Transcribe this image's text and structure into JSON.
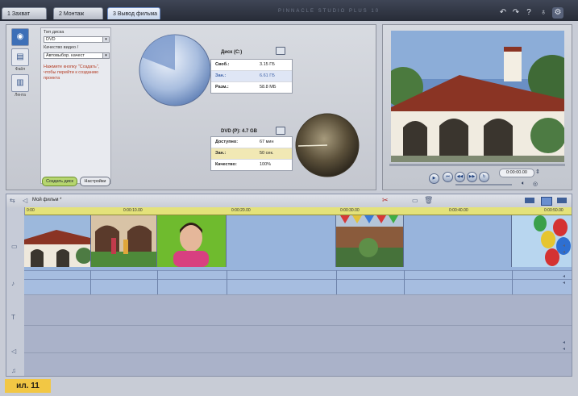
{
  "tabs": [
    {
      "label": "1 Захват"
    },
    {
      "label": "2 Монтаж"
    },
    {
      "label": "3 Вывод фильма"
    }
  ],
  "brand_text": "PINNACLE STUDIO PLUS 10",
  "toolbar_icons": [
    "undo-icon",
    "redo-icon",
    "help-icon",
    "tip-icon",
    "settings-icon"
  ],
  "disc_panel": {
    "side_buttons": [
      {
        "label": ""
      },
      {
        "label": "Файл"
      },
      {
        "label": "Лента"
      }
    ],
    "disc_type_label": "Тип диска",
    "disc_type_value": "DVD",
    "quality_label": "Качество видео /",
    "quality_value": "Автовыбор. качест",
    "hint": "Нажмите кнопку \"Создать\", чтобы перейти к созданию проекта",
    "create_button": "Создать диск",
    "settings_button": "Настройки",
    "disk_c": {
      "title": "Диск (C:)",
      "rows": [
        {
          "key": "Своб.:",
          "value": "3.15 ГБ"
        },
        {
          "key": "Зан.:",
          "value": "6.61 ГБ"
        },
        {
          "key": "Разм.:",
          "value": "58.8 МБ"
        }
      ]
    },
    "dvd": {
      "title": "DVD (Р): 4.7 GB",
      "rows": [
        {
          "key": "Доступно:",
          "value": "67 мин"
        },
        {
          "key": "Зан.:",
          "value": "50 сек."
        },
        {
          "key": "Качество:",
          "value": "100%"
        }
      ]
    }
  },
  "preview": {
    "timecode": "0:00:00.00"
  },
  "timeline": {
    "title": "Мой фильм *",
    "ruler_ticks": [
      "0:00",
      "0:00:10.00",
      "0:00:20.00",
      "0:00:30.00",
      "0:00:40.00",
      "0:00:50.00"
    ]
  },
  "caption": "ил. 11",
  "colors": {
    "accent": "#3d6fb7",
    "ruler": "#e4e27a",
    "video_track": "#98b4dc",
    "caption_bg": "#f2c744"
  }
}
